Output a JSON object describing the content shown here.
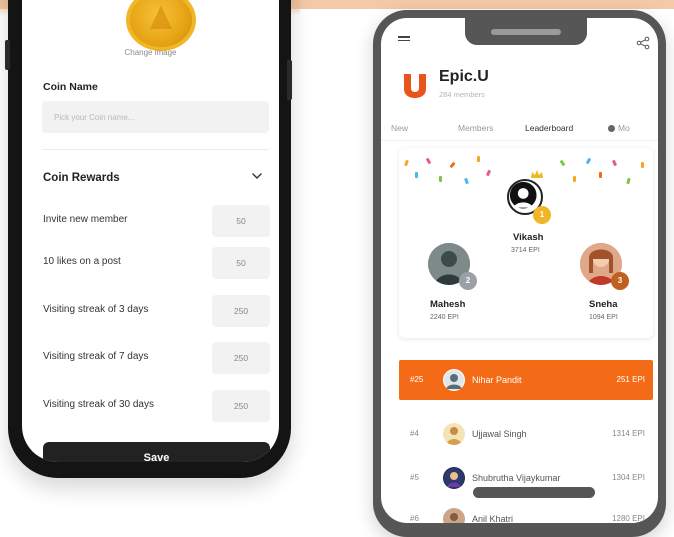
{
  "left_screen": {
    "change_image": "Change image",
    "coin_name_label": "Coin Name",
    "coin_name_placeholder": "Pick your Coin name...",
    "coin_rewards_title": "Coin Rewards",
    "rewards": [
      {
        "label": "Invite new member",
        "value": "50"
      },
      {
        "label": "10 likes on a post",
        "value": "50"
      },
      {
        "label": "Visiting streak of 3 days",
        "value": "250"
      },
      {
        "label": "Visiting streak of 7 days",
        "value": "250"
      },
      {
        "label": "Visiting streak of 30 days",
        "value": "250"
      }
    ],
    "save_label": "Save"
  },
  "right_screen": {
    "logo_letter": "U",
    "community_name": "Epic.U",
    "members_count": "284 members",
    "tabs": [
      "New",
      "Members",
      "Leaderboard",
      "Mo"
    ],
    "active_tab": "Leaderboard",
    "podium": [
      {
        "rank": "1",
        "name": "Vikash",
        "points": "3714 EPI"
      },
      {
        "rank": "2",
        "name": "Mahesh",
        "points": "2240 EPI"
      },
      {
        "rank": "3",
        "name": "Sneha",
        "points": "1094 EPI"
      }
    ],
    "current_user": {
      "rank": "#25",
      "name": "Nihar Pandit",
      "points": "251 EPI"
    },
    "list": [
      {
        "rank": "#4",
        "name": "Ujjawal Singh",
        "points": "1314 EPI"
      },
      {
        "rank": "#5",
        "name": "Shubrutha Vijaykumar",
        "points": "1304 EPI"
      },
      {
        "rank": "#6",
        "name": "Anil Khatri",
        "points": "1280 EPI"
      }
    ]
  },
  "colors": {
    "accent_orange": "#f36b16",
    "gold": "#f0b626",
    "phone_frame_dark": "#141414",
    "phone_frame_gray": "#565656"
  }
}
